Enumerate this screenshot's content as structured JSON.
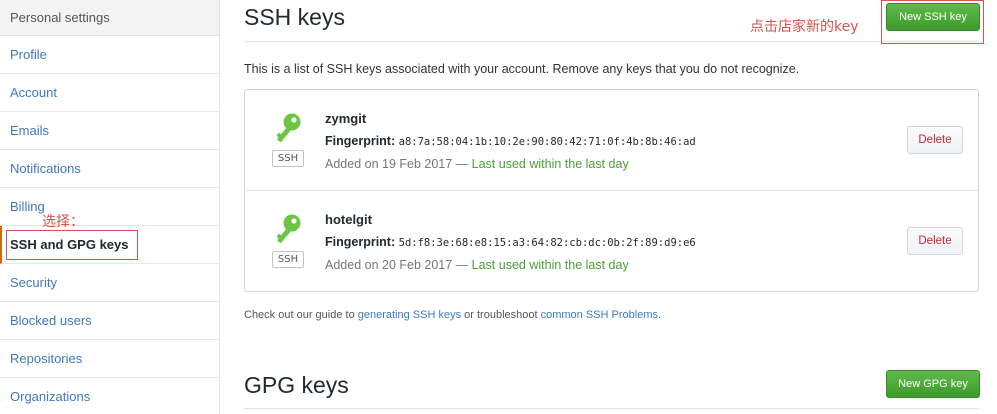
{
  "sidebar": {
    "header": "Personal settings",
    "items": [
      {
        "label": "Profile"
      },
      {
        "label": "Account"
      },
      {
        "label": "Emails"
      },
      {
        "label": "Notifications"
      },
      {
        "label": "Billing"
      },
      {
        "label": "SSH and GPG keys"
      },
      {
        "label": "Security"
      },
      {
        "label": "Blocked users"
      },
      {
        "label": "Repositories"
      },
      {
        "label": "Organizations"
      }
    ],
    "selected": "SSH and GPG keys"
  },
  "annotations": {
    "select_note": "选择：",
    "new_key_note": "点击店家新的key"
  },
  "ssh": {
    "title": "SSH keys",
    "new_button": "New SSH key",
    "intro": "This is a list of SSH keys associated with your account. Remove any keys that you do not recognize.",
    "keys": [
      {
        "type_label": "SSH",
        "name": "zymgit",
        "fingerprint_label": "Fingerprint:",
        "fingerprint": "a8:7a:58:04:1b:10:2e:90:80:42:71:0f:4b:8b:46:ad",
        "added": "Added on 19 Feb 2017 —",
        "last_used": "Last used within the last day",
        "delete_label": "Delete"
      },
      {
        "type_label": "SSH",
        "name": "hotelgit",
        "fingerprint_label": "Fingerprint:",
        "fingerprint": "5d:f8:3e:68:e8:15:a3:64:82:cb:dc:0b:2f:89:d9:e6",
        "added": "Added on 20 Feb 2017 —",
        "last_used": "Last used within the last day",
        "delete_label": "Delete"
      }
    ],
    "guide": {
      "prefix": "Check out our guide to",
      "link1": "generating SSH keys",
      "middle": "or troubleshoot",
      "link2": "common SSH Problems",
      "suffix": "."
    }
  },
  "gpg": {
    "title": "GPG keys",
    "new_button": "New GPG key"
  },
  "colors": {
    "link": "#4078c0",
    "green_button": "#4aab35",
    "annotation_red": "#d9534f",
    "key_icon": "#6cc644",
    "delete_text": "#cb2431"
  }
}
